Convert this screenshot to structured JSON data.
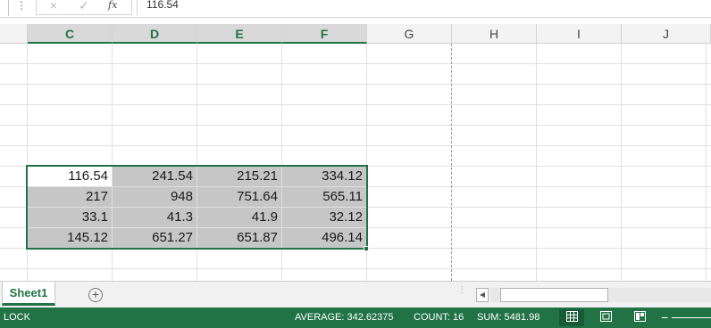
{
  "formula_bar": {
    "cancel_icon": "×",
    "enter_icon": "✓",
    "fx_label": "fx",
    "value": "116.54"
  },
  "columns": [
    "C",
    "D",
    "E",
    "F",
    "G",
    "H",
    "I",
    "J"
  ],
  "selected_columns": [
    "C",
    "D",
    "E",
    "F"
  ],
  "cells": [
    [
      "116.54",
      "241.54",
      "215.21",
      "334.12"
    ],
    [
      "217",
      "948",
      "751.64",
      "565.11"
    ],
    [
      "33.1",
      "41.3",
      "41.9",
      "32.12"
    ],
    [
      "145.12",
      "651.27",
      "651.87",
      "496.14"
    ]
  ],
  "active_cell_value": "116.54",
  "sheet_tabs": {
    "active": "Sheet1",
    "add_icon": "+"
  },
  "status_bar": {
    "mode": "LOCK",
    "average": "AVERAGE: 342.62375",
    "count": "COUNT: 16",
    "sum": "SUM: 5481.98",
    "view_normal_icon": "grid-icon",
    "view_page_layout_icon": "page-layout-icon",
    "view_page_break_icon": "page-break-icon",
    "zoom_out_icon": "−"
  },
  "colors": {
    "accent": "#217346",
    "selection_fill": "#c6c6c6"
  }
}
